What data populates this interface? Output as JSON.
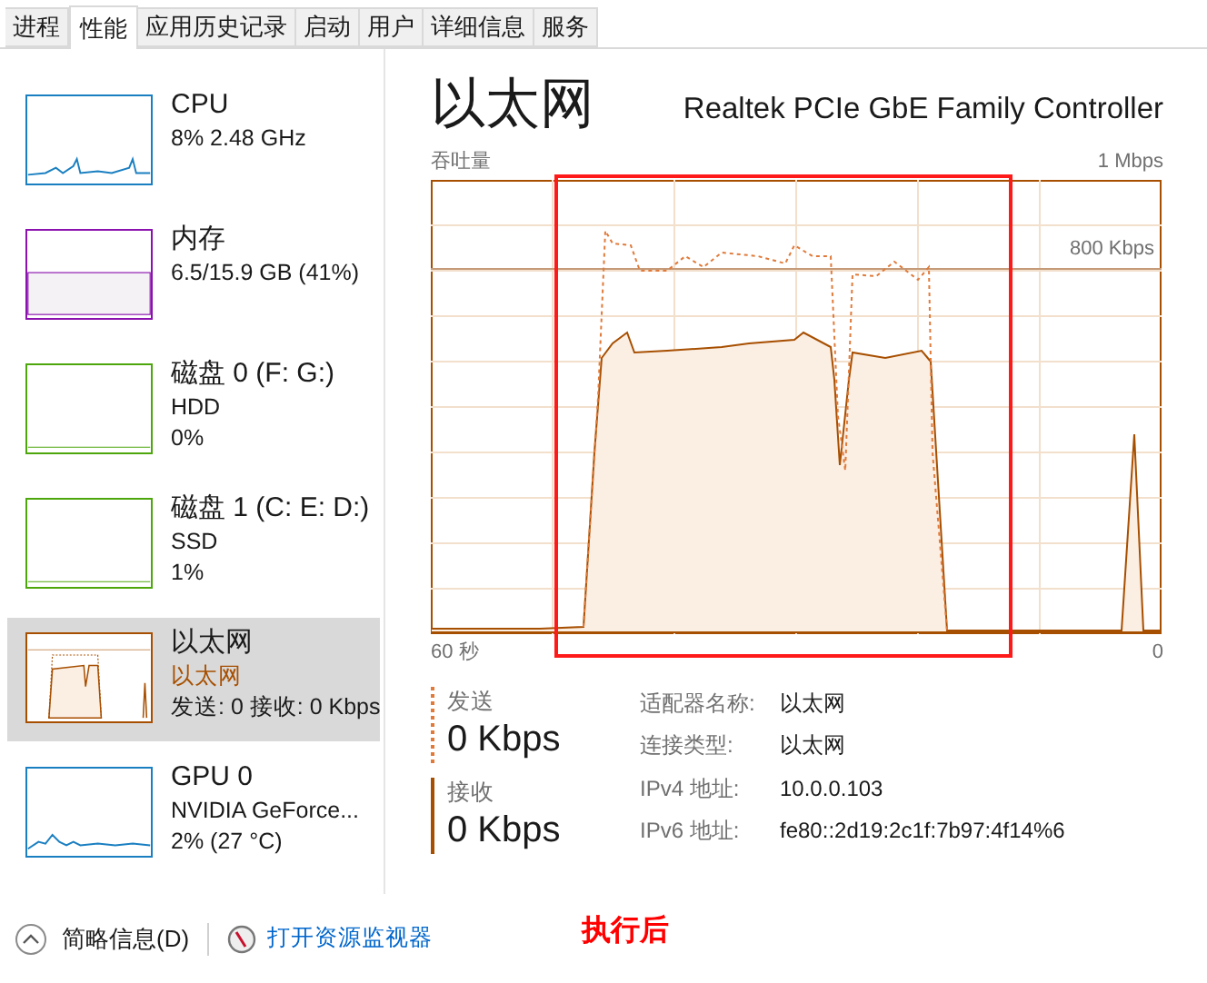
{
  "tabs": [
    {
      "label": "进程",
      "selected": false
    },
    {
      "label": "性能",
      "selected": true
    },
    {
      "label": "应用历史记录",
      "selected": false
    },
    {
      "label": "启动",
      "selected": false
    },
    {
      "label": "用户",
      "selected": false
    },
    {
      "label": "详细信息",
      "selected": false
    },
    {
      "label": "服务",
      "selected": false
    }
  ],
  "sidebar": {
    "items": [
      {
        "kind": "cpu",
        "title": "CPU",
        "lines": [
          "8% 2.48 GHz"
        ],
        "color": "#1a7fc1",
        "selected": false
      },
      {
        "kind": "memory",
        "title": "内存",
        "lines": [
          "6.5/15.9 GB (41%)"
        ],
        "color": "#8b12ae",
        "selected": false
      },
      {
        "kind": "disk",
        "title": "磁盘 0 (F: G:)",
        "lines": [
          "HDD",
          "0%"
        ],
        "color": "#4da60c",
        "selected": false
      },
      {
        "kind": "disk",
        "title": "磁盘 1 (C: E: D:)",
        "lines": [
          "SSD",
          "1%"
        ],
        "color": "#4da60c",
        "selected": false
      },
      {
        "kind": "ethernet",
        "title": "以太网",
        "lines": [
          "以太网",
          "发送: 0 接收: 0 Kbps"
        ],
        "color": "#a74f01",
        "selected": true
      },
      {
        "kind": "gpu",
        "title": "GPU 0",
        "lines": [
          "NVIDIA GeForce...",
          "2% (27 °C)"
        ],
        "color": "#1a7fc1",
        "selected": false
      }
    ]
  },
  "detail": {
    "title": "以太网",
    "adapter": "Realtek PCIe GbE Family Controller",
    "graph_label": "吞吐量",
    "graph_max": "1 Mbps",
    "graph_line_label": "800 Kbps",
    "time_start": "60 秒",
    "time_end": "0",
    "send": {
      "label": "发送",
      "value": "0 Kbps"
    },
    "receive": {
      "label": "接收",
      "value": "0 Kbps"
    },
    "properties": [
      {
        "label": "适配器名称:",
        "value": "以太网"
      },
      {
        "label": "连接类型:",
        "value": "以太网"
      },
      {
        "label": "IPv4 地址:",
        "value": "10.0.0.103"
      },
      {
        "label": "IPv6 地址:",
        "value": "fe80::2d19:2c1f:7b97:4f14%6"
      }
    ]
  },
  "footer": {
    "fewer_details": "简略信息(D)",
    "open_monitor": "打开资源监视器"
  },
  "annotation": {
    "text": "执行后"
  }
}
